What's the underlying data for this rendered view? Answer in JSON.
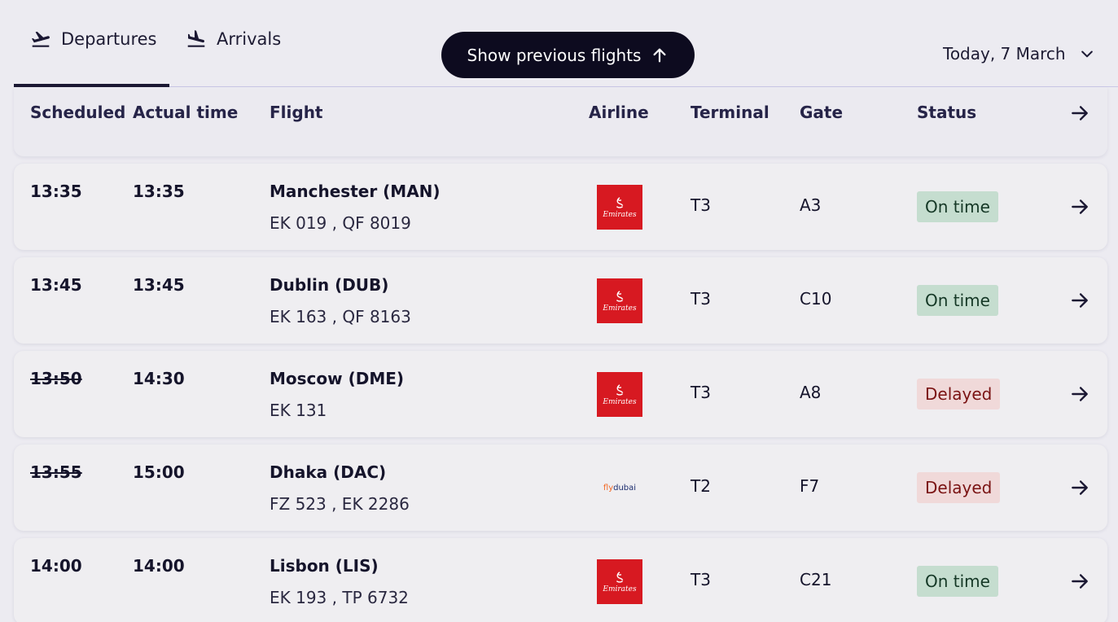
{
  "tabs": {
    "departures": "Departures",
    "arrivals": "Arrivals"
  },
  "prev_button": "Show previous flights",
  "date_select": "Today, 7 March",
  "columns": {
    "scheduled": "Scheduled",
    "actual": "Actual time",
    "flight": "Flight",
    "airline": "Airline",
    "terminal": "Terminal",
    "gate": "Gate",
    "status": "Status"
  },
  "flights": [
    {
      "scheduled": "13:35",
      "scheduled_struck": false,
      "actual": "13:35",
      "destination": "Manchester (MAN)",
      "codes": "EK 019 , QF 8019",
      "airline_logo": "emirates-logo",
      "airline_word": "Emirates",
      "terminal": "T3",
      "gate": "A3",
      "status": "On time",
      "status_type": "ontime"
    },
    {
      "scheduled": "13:45",
      "scheduled_struck": false,
      "actual": "13:45",
      "destination": "Dublin (DUB)",
      "codes": "EK 163 , QF 8163",
      "airline_logo": "emirates-logo",
      "airline_word": "Emirates",
      "terminal": "T3",
      "gate": "C10",
      "status": "On time",
      "status_type": "ontime"
    },
    {
      "scheduled": "13:50",
      "scheduled_struck": true,
      "actual": "14:30",
      "destination": "Moscow (DME)",
      "codes": "EK 131",
      "airline_logo": "emirates-logo",
      "airline_word": "Emirates",
      "terminal": "T3",
      "gate": "A8",
      "status": "Delayed",
      "status_type": "delayed"
    },
    {
      "scheduled": "13:55",
      "scheduled_struck": true,
      "actual": "15:00",
      "destination": "Dhaka (DAC)",
      "codes": "FZ 523 , EK 2286",
      "airline_logo": "flydubai-logo",
      "airline_word_fly": "fly",
      "airline_word_dubai": "dubai",
      "terminal": "T2",
      "gate": "F7",
      "status": "Delayed",
      "status_type": "delayed"
    },
    {
      "scheduled": "14:00",
      "scheduled_struck": false,
      "actual": "14:00",
      "destination": "Lisbon (LIS)",
      "codes": "EK 193 , TP 6732",
      "airline_logo": "emirates-logo",
      "airline_word": "Emirates",
      "terminal": "T3",
      "gate": "C21",
      "status": "On time",
      "status_type": "ontime"
    }
  ],
  "icons": {
    "departures": "plane-takeoff-icon",
    "arrivals": "plane-landing-icon",
    "prev": "arrow-up-icon",
    "date": "chevron-down-icon",
    "row": "arrow-right-icon"
  }
}
